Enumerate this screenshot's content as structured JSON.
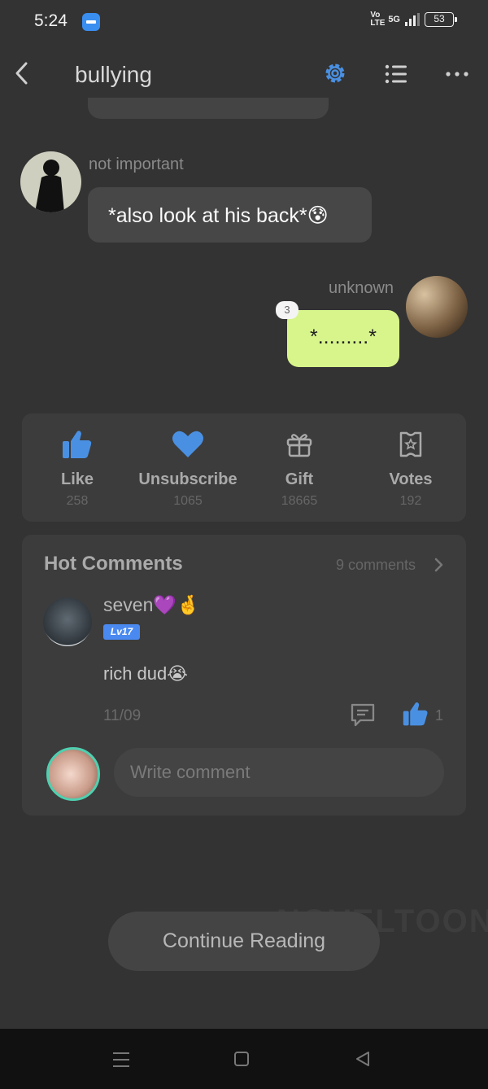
{
  "status_bar": {
    "time": "5:24",
    "volte": "Vo LTE",
    "network": "5G",
    "battery": "53"
  },
  "header": {
    "title": "bullying"
  },
  "messages": [
    {
      "sender": "not important",
      "text": "*also look at his back*😰",
      "side": "left"
    },
    {
      "sender": "unknown",
      "text": "*.........*",
      "side": "right",
      "badge": "3"
    }
  ],
  "actions": [
    {
      "label": "Like",
      "count": "258",
      "icon": "thumbs-up-icon"
    },
    {
      "label": "Unsubscribe",
      "count": "1065",
      "icon": "heart-icon"
    },
    {
      "label": "Gift",
      "count": "18665",
      "icon": "gift-icon"
    },
    {
      "label": "Votes",
      "count": "192",
      "icon": "vote-ticket-icon"
    }
  ],
  "comments": {
    "title": "Hot Comments",
    "count_label": "9 comments",
    "items": [
      {
        "user": "seven💜🤞",
        "level": "Lv17",
        "text": "rich dud😭",
        "date": "11/09",
        "likes": "1"
      }
    ],
    "input_placeholder": "Write comment"
  },
  "watermark": "NOVELTOON",
  "continue_label": "Continue Reading",
  "colors": {
    "accent": "#4a90e2",
    "my_bubble": "#d7f58b",
    "background": "#333333"
  }
}
